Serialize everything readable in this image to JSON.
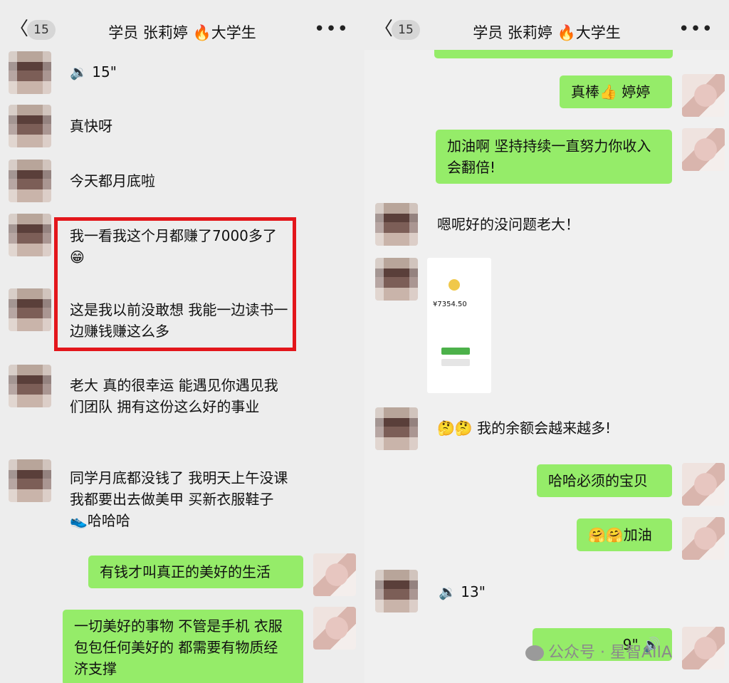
{
  "left_screen": {
    "header": {
      "back_count": "15",
      "title": "学员 张莉婷 🔥大学生",
      "more": "•••"
    },
    "messages": [
      {
        "type": "voice",
        "text": "15\""
      },
      {
        "text": "真快呀"
      },
      {
        "text": "今天都月底啦"
      },
      {
        "text": "我一看我这个月都赚了7000多了😁"
      },
      {
        "text": "这是我以前没敢想 我能一边读书一边赚钱赚这么多"
      },
      {
        "text": "老大 真的很幸运 能遇见你遇见我们团队 拥有这份这么好的事业"
      },
      {
        "text": "同学月底都没钱了 我明天上午没课 我都要出去做美甲 买新衣服鞋子👟哈哈哈"
      },
      {
        "text": "有钱才叫真正的美好的生活"
      },
      {
        "text": "一切美好的事物 不管是手机 衣服 包包任何美好的 都需要有物质经济支撑"
      }
    ]
  },
  "right_screen": {
    "header": {
      "back_count": "15",
      "title": "学员 张莉婷 🔥大学生",
      "more": "•••"
    },
    "messages": [
      {
        "text": "真棒👍 婷婷"
      },
      {
        "text": "加油啊 坚持持续一直努力你收入会翻倍!"
      },
      {
        "text": "嗯呢好的没问题老大！"
      },
      {
        "type": "image",
        "amount": "¥7354.50"
      },
      {
        "text": "🤔🤔 我的余额会越来越多!"
      },
      {
        "text": "哈哈必须的宝贝"
      },
      {
        "text": "🤗🤗加油"
      },
      {
        "type": "voice",
        "text": "13\""
      },
      {
        "type": "voice",
        "text": "9\""
      }
    ]
  },
  "watermark": "公众号 · 星智AIIA"
}
